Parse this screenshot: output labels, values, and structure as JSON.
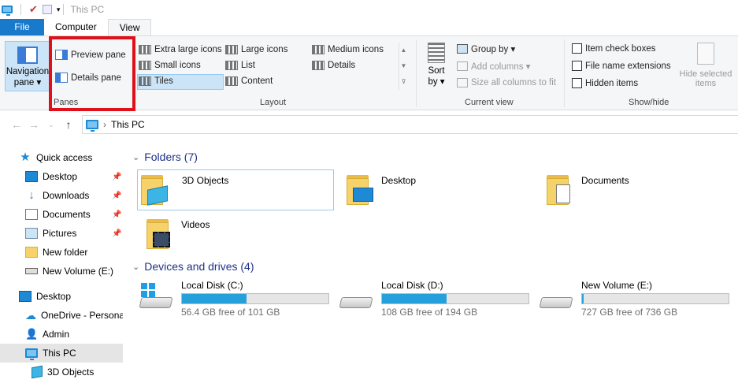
{
  "window": {
    "title": "This PC"
  },
  "tabs": [
    {
      "label": "File"
    },
    {
      "label": "Computer"
    },
    {
      "label": "View"
    }
  ],
  "ribbon": {
    "navigation_pane": "Navigation\npane ▾",
    "navigation_pane_line1": "Navigation",
    "navigation_pane_line2": "pane ▾",
    "panes": {
      "preview_pane": "Preview pane",
      "details_pane": "Details pane",
      "group": "Panes"
    },
    "layout": {
      "items": [
        "Extra large icons",
        "Large icons",
        "Medium icons",
        "Small icons",
        "List",
        "Details",
        "Tiles",
        "Content"
      ],
      "selected": "Tiles",
      "group": "Layout"
    },
    "current_view": {
      "sort_by_line1": "Sort",
      "sort_by_line2": "by ▾",
      "group_by": "Group by ▾",
      "add_columns": "Add columns ▾",
      "size_columns": "Size all columns to fit",
      "group": "Current view"
    },
    "show_hide": {
      "item_check_boxes": "Item check boxes",
      "file_name_extensions": "File name extensions",
      "hidden_items": "Hidden items",
      "hide_selected_line1": "Hide selected",
      "hide_selected_line2": "items",
      "group": "Show/hide"
    }
  },
  "address": {
    "path": "This PC",
    "separator": "›"
  },
  "sidebar": {
    "items": [
      {
        "label": "Quick access",
        "icon": "star-icon"
      },
      {
        "label": "Desktop",
        "icon": "desktop-icon",
        "pinned": true
      },
      {
        "label": "Downloads",
        "icon": "download-icon",
        "pinned": true
      },
      {
        "label": "Documents",
        "icon": "documents-icon",
        "pinned": true
      },
      {
        "label": "Pictures",
        "icon": "pictures-icon",
        "pinned": true
      },
      {
        "label": "New folder",
        "icon": "folder-icon"
      },
      {
        "label": "New Volume (E:)",
        "icon": "drive-icon"
      },
      {
        "label": "Desktop",
        "icon": "desktop-icon"
      },
      {
        "label": "OneDrive - Persona",
        "icon": "cloud-icon"
      },
      {
        "label": "Admin",
        "icon": "user-icon"
      },
      {
        "label": "This PC",
        "icon": "pc-icon",
        "selected": true
      },
      {
        "label": "3D Objects",
        "icon": "3d-objects-icon"
      }
    ]
  },
  "content": {
    "folders_header": "Folders (7)",
    "folders": [
      {
        "name": "3D Objects"
      },
      {
        "name": "Desktop"
      },
      {
        "name": "Documents"
      },
      {
        "name": "Videos"
      }
    ],
    "drives_header": "Devices and drives (4)",
    "drives": [
      {
        "name": "Local Disk (C:)",
        "free": "56.4 GB free of 101 GB",
        "used_fraction": 0.44
      },
      {
        "name": "Local Disk (D:)",
        "free": "108 GB free of 194 GB",
        "used_fraction": 0.44
      },
      {
        "name": "New Volume (E:)",
        "free": "727 GB free of 736 GB",
        "used_fraction": 0.012
      }
    ]
  },
  "colors": {
    "accent": "#1979ca",
    "highlight": "#e0101a",
    "bar_fill": "#26a0da",
    "section_text": "#1e3287"
  }
}
